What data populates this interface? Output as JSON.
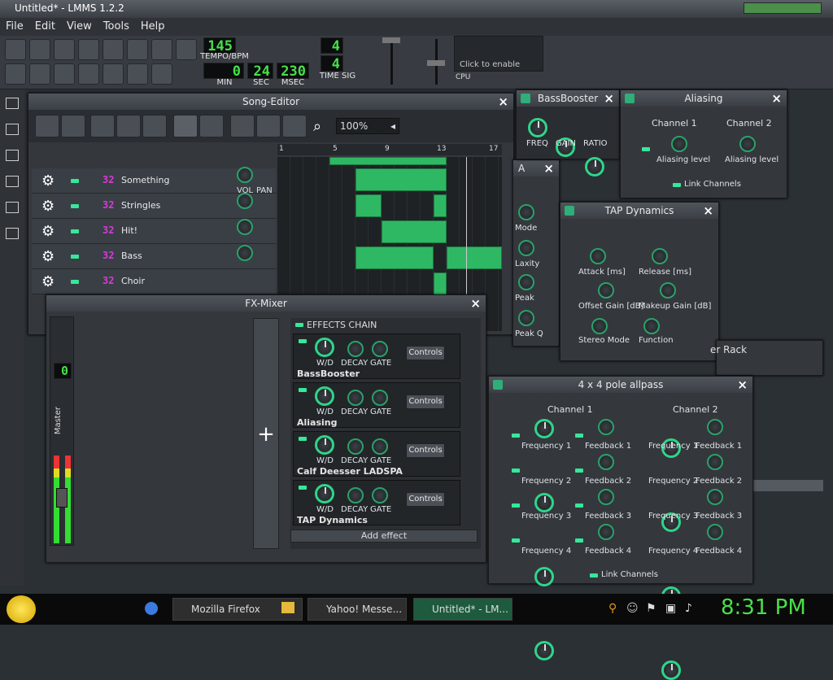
{
  "window": {
    "title": "Untitled* - LMMS 1.2.2"
  },
  "menu": [
    "File",
    "Edit",
    "View",
    "Tools",
    "Help"
  ],
  "transport": {
    "tempo": "145",
    "tempo_label": "TEMPO/BPM",
    "min": "0",
    "sec": "24",
    "msec": "230",
    "min_label": "MIN",
    "sec_label": "SEC",
    "msec_label": "MSEC",
    "ts_num": "4",
    "ts_den": "4",
    "ts_label": "TIME SIG",
    "cpu_hint": "Click to enable",
    "cpu_label": "CPU"
  },
  "song_editor": {
    "title": "Song-Editor",
    "zoom": "100%",
    "ruler": [
      "1",
      "5",
      "9",
      "13",
      "17"
    ],
    "tracks": [
      {
        "name": "Something"
      },
      {
        "name": "Stringles"
      },
      {
        "name": "Hit!"
      },
      {
        "name": "Bass"
      },
      {
        "name": "Choir"
      }
    ],
    "vol": "VOL",
    "pan": "PAN"
  },
  "fx_mixer": {
    "title": "FX-Mixer",
    "channel": "Master",
    "channel_num": "0",
    "chain_label": "EFFECTS CHAIN",
    "add_effect": "Add effect",
    "effects": [
      {
        "name": "BassBooster"
      },
      {
        "name": "Aliasing"
      },
      {
        "name": "Calf Deesser LADSPA"
      },
      {
        "name": "TAP Dynamics"
      }
    ],
    "wd": "W/D",
    "decay": "DECAY",
    "gate": "GATE",
    "controls": "Controls"
  },
  "bassbooster": {
    "title": "BassBooster",
    "knobs": [
      "FREQ",
      "GAIN",
      "RATIO"
    ]
  },
  "aliasing": {
    "title": "Aliasing",
    "ch1": "Channel 1",
    "ch2": "Channel 2",
    "knob": "Aliasing level",
    "link": "Link Channels"
  },
  "partial": {
    "title": "A",
    "labels": [
      "Mode",
      "Laxity",
      "Peak",
      "Peak Q"
    ]
  },
  "tap": {
    "title": "TAP Dynamics",
    "knobs": [
      "Attack [ms]",
      "Release [ms]",
      "Offset Gain [dB]",
      "Makeup Gain [dB]",
      "Stereo Mode",
      "Function"
    ]
  },
  "rack_label": "er Rack",
  "allpass": {
    "title": "4 x 4 pole allpass",
    "ch1": "Channel 1",
    "ch2": "Channel 2",
    "freq": [
      "Frequency 1",
      "Frequency 2",
      "Frequency 3",
      "Frequency 4"
    ],
    "fb": [
      "Feedback 1",
      "Feedback 2",
      "Feedback 3",
      "Feedback 4"
    ],
    "link": "Link Channels"
  },
  "taskbar": {
    "items": [
      "Mozilla Firefox",
      "Yahoo! Messe...",
      "Untitled* - LM..."
    ],
    "clock": "8:31 PM"
  }
}
